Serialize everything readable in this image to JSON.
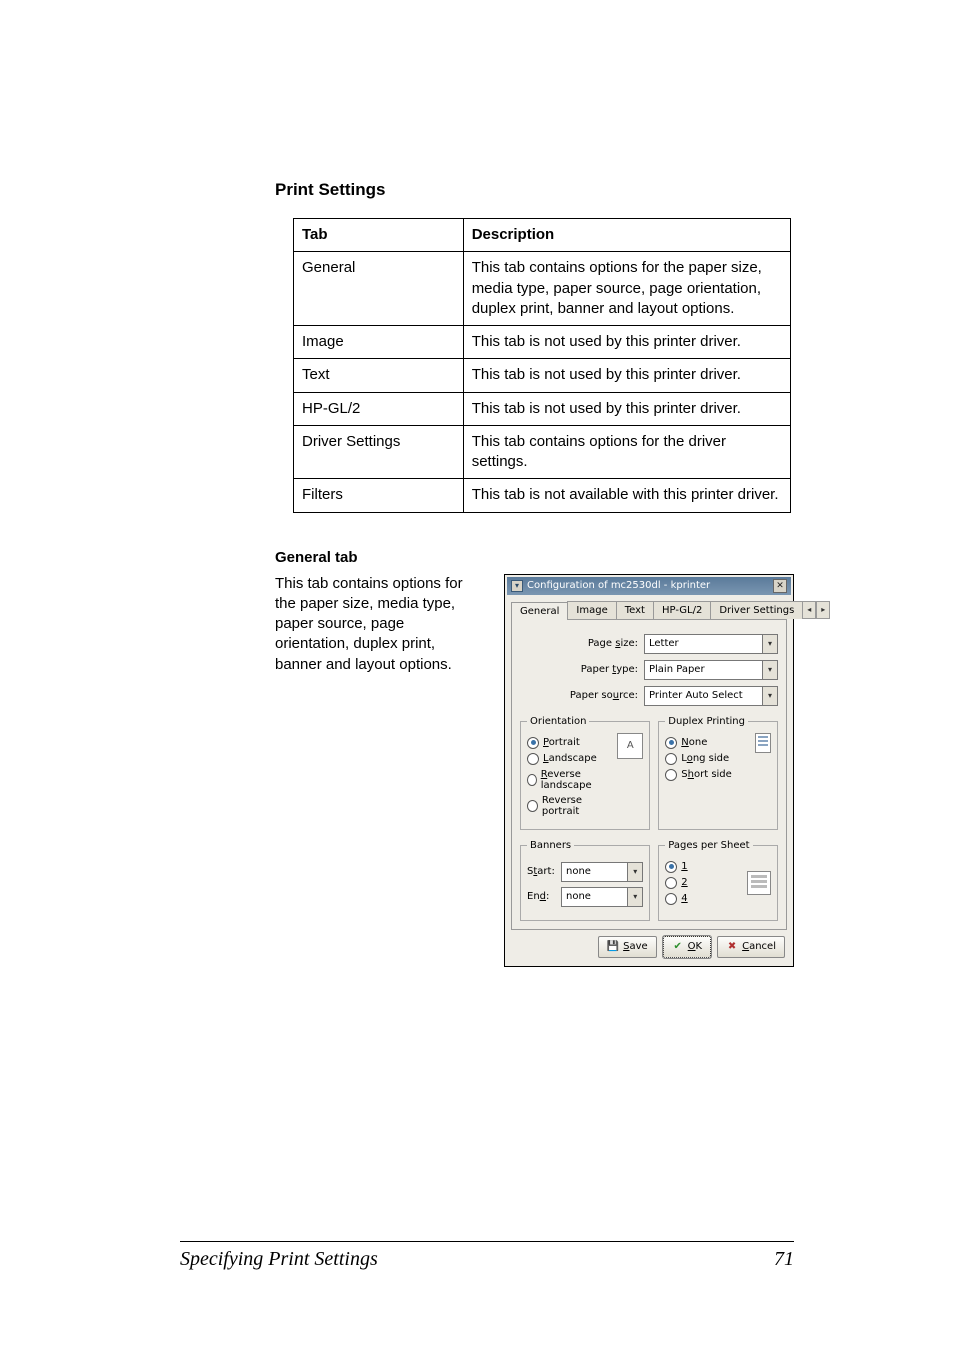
{
  "headings": {
    "print_settings": "Print Settings",
    "general_tab": "General tab"
  },
  "table": {
    "headers": {
      "tab": "Tab",
      "desc": "Description"
    },
    "rows": [
      {
        "tab": "General",
        "desc": "This tab contains options for the paper size, media type, paper source, page orientation, duplex print, banner and layout options."
      },
      {
        "tab": "Image",
        "desc": "This tab is not used by this printer driver."
      },
      {
        "tab": "Text",
        "desc": "This tab is not used by this printer driver."
      },
      {
        "tab": "HP-GL/2",
        "desc": "This tab is not used by this printer driver."
      },
      {
        "tab": "Driver Settings",
        "desc": "This tab contains options for the driver settings."
      },
      {
        "tab": "Filters",
        "desc": "This tab is not available with this printer driver."
      }
    ]
  },
  "body_text": "This tab contains options for the paper size, media type, paper source, page orientation, duplex print, banner and layout options.",
  "dialog": {
    "title": "Configuration of mc2530dl - kprinter",
    "tabs": {
      "general": "General",
      "image": "Image",
      "text": "Text",
      "hpgl2": "HP-GL/2",
      "driver": "Driver Settings",
      "nav_prev": "◂",
      "nav_next": "▸"
    },
    "fields": {
      "page_size_label": "Page size:",
      "page_size_value": "Letter",
      "paper_type_label": "Paper type:",
      "paper_type_value": "Plain Paper",
      "paper_source_label": "Paper source:",
      "paper_source_value": "Printer Auto Select"
    },
    "orientation": {
      "legend": "Orientation",
      "portrait": "Portrait",
      "landscape": "Landscape",
      "rev_landscape": "Reverse landscape",
      "rev_portrait": "Reverse portrait"
    },
    "duplex": {
      "legend": "Duplex Printing",
      "none": "None",
      "long": "Long side",
      "short": "Short side"
    },
    "banners": {
      "legend": "Banners",
      "start_label": "Start:",
      "end_label": "End:",
      "value": "none"
    },
    "pps": {
      "legend": "Pages per Sheet",
      "o1": "1",
      "o2": "2",
      "o4": "4"
    },
    "buttons": {
      "save": "Save",
      "ok": "OK",
      "cancel": "Cancel"
    },
    "underline": {
      "s": "s",
      "t": "t",
      "u": "u",
      "P": "P",
      "L": "L",
      "R": "R",
      "N": "N",
      "o": "o",
      "h": "h",
      "one": "1",
      "two": "2",
      "four": "4",
      "Sbtn": "S",
      "Obtn": "O",
      "Cbtn": "C",
      "d": "d"
    }
  },
  "footer": {
    "title": "Specifying Print Settings",
    "page": "71"
  }
}
